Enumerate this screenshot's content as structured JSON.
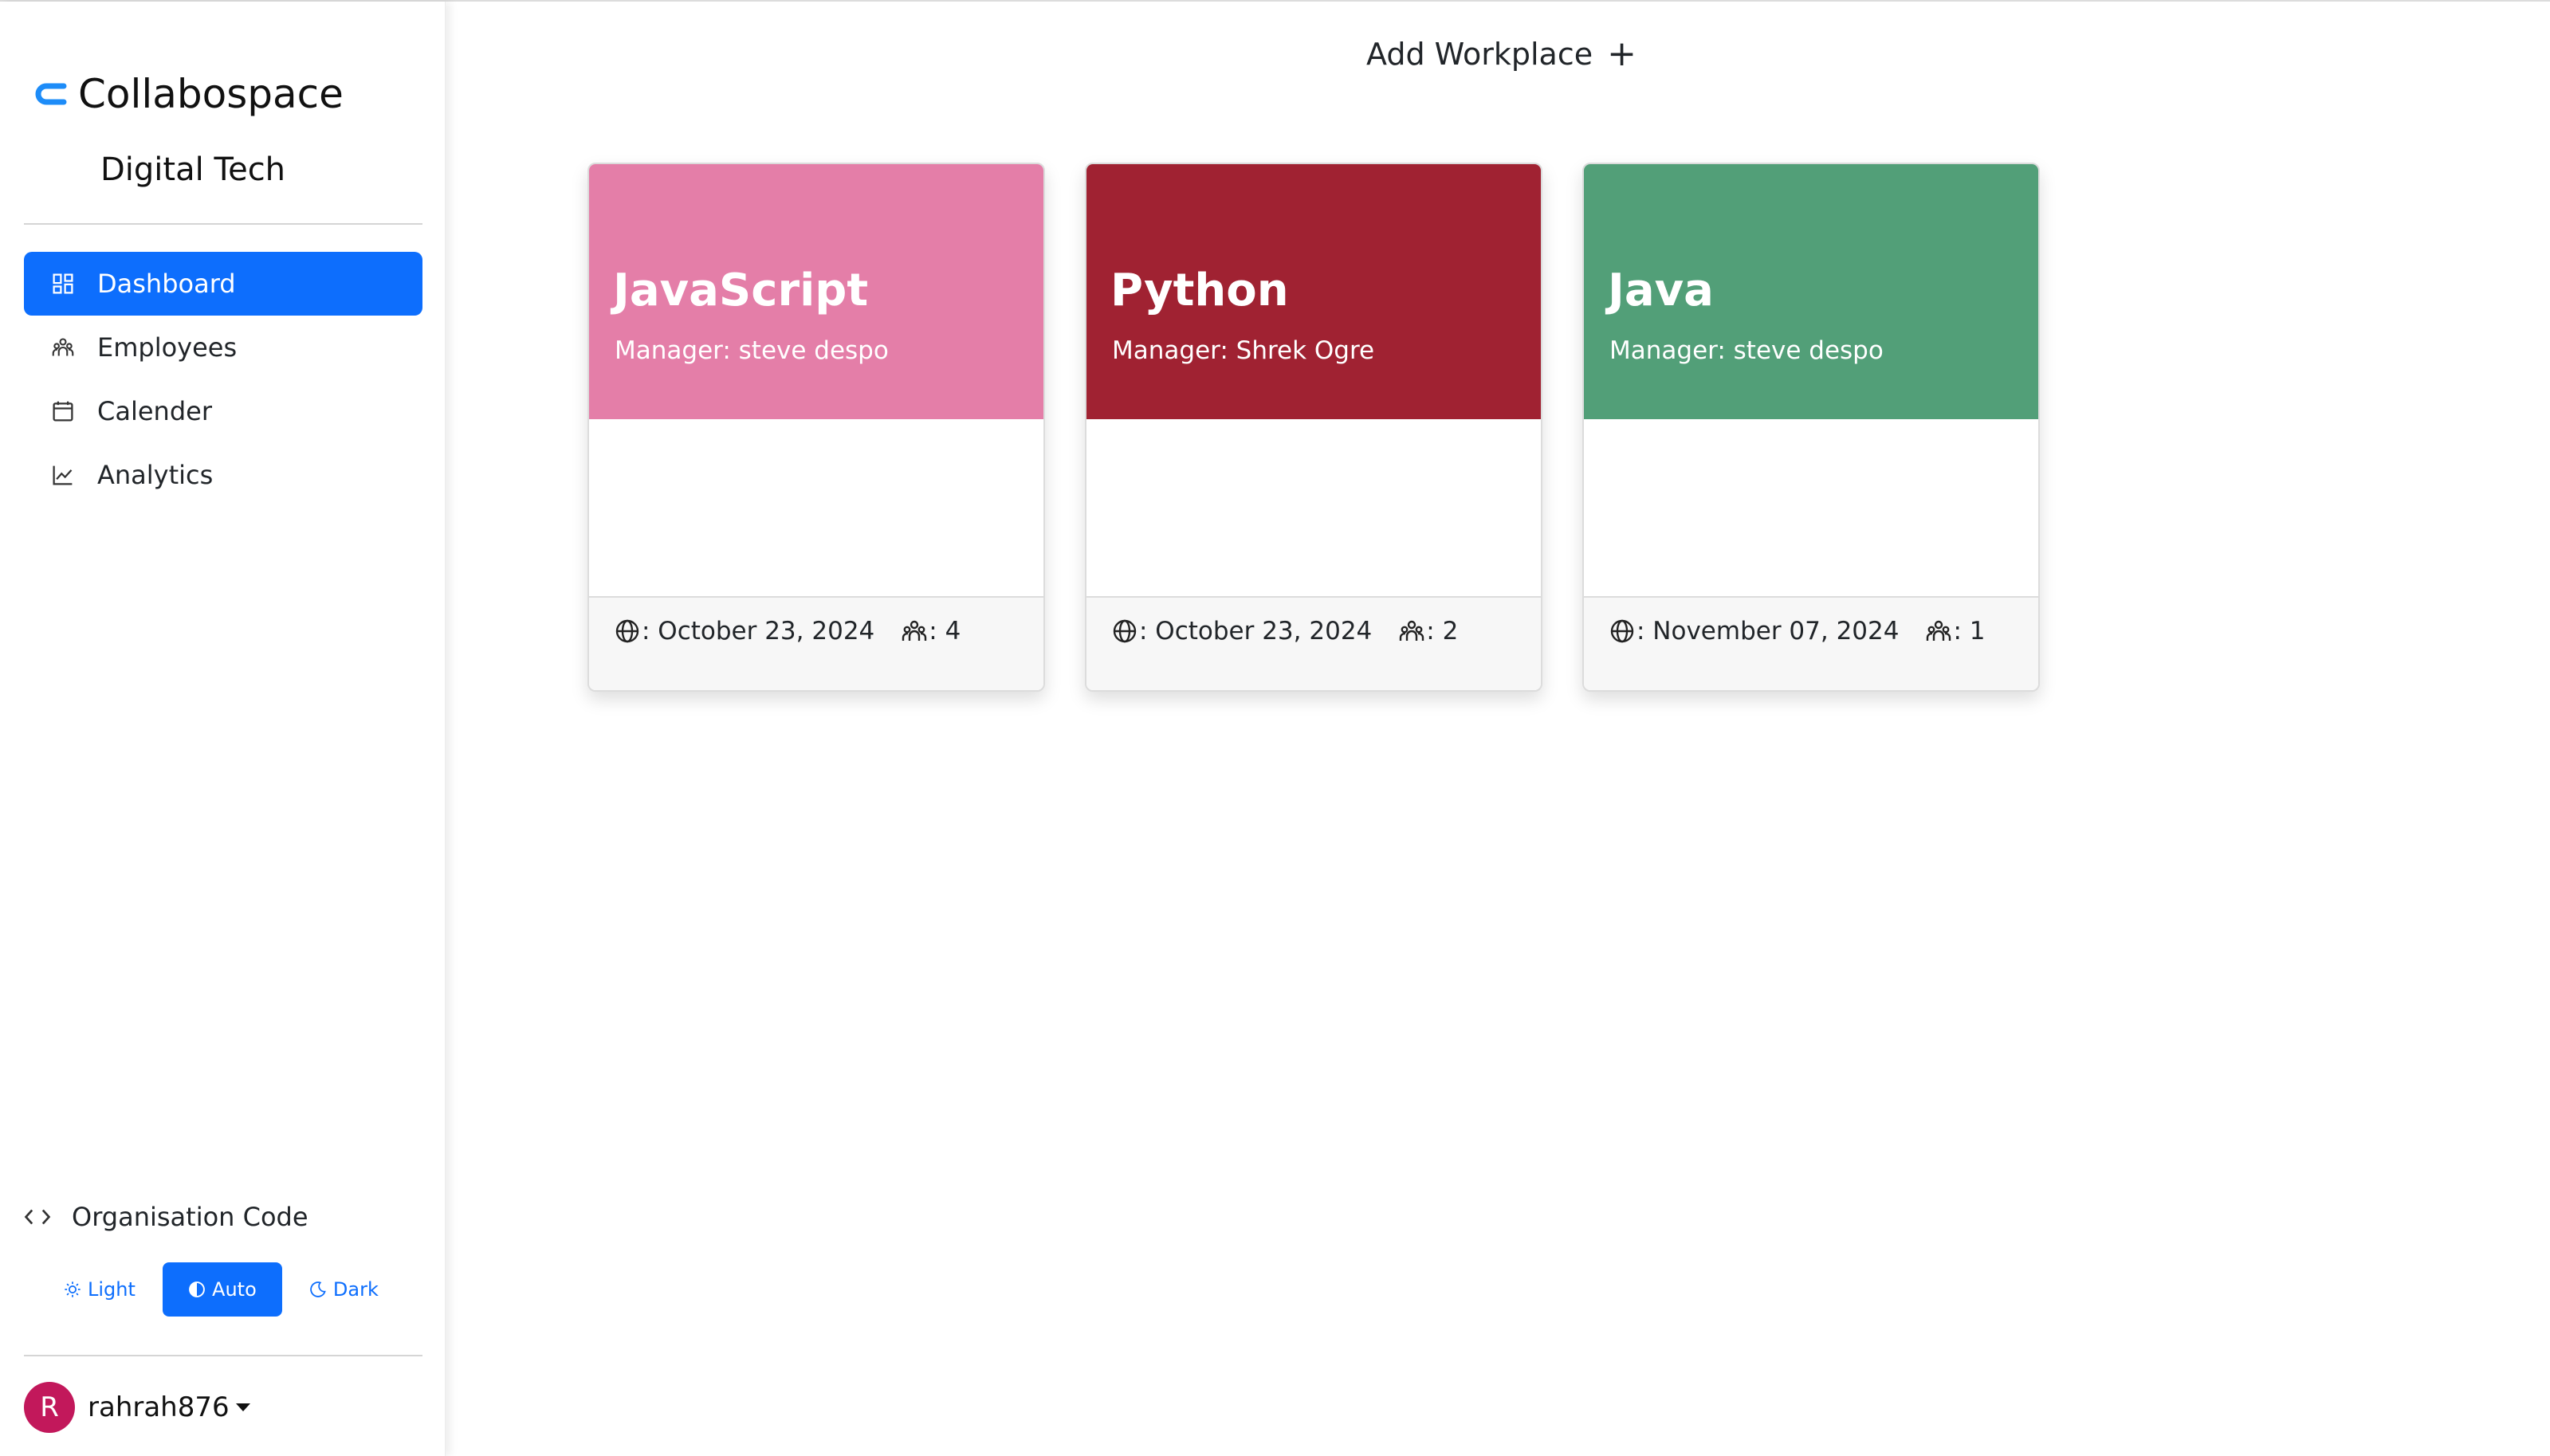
{
  "app": {
    "name": "Collabospace",
    "brand_color": "#0d6efd"
  },
  "organisation": {
    "name": "Digital Tech",
    "code_label": "Organisation Code"
  },
  "sidebar": {
    "items": [
      {
        "label": "Dashboard",
        "icon": "dashboard-icon",
        "active": true
      },
      {
        "label": "Employees",
        "icon": "people-icon",
        "active": false
      },
      {
        "label": "Calender",
        "icon": "calendar-icon",
        "active": false
      },
      {
        "label": "Analytics",
        "icon": "chart-line-icon",
        "active": false
      }
    ]
  },
  "theme": {
    "options": [
      {
        "label": "Light",
        "icon": "sun-icon"
      },
      {
        "label": "Auto",
        "icon": "circle-half-icon"
      },
      {
        "label": "Dark",
        "icon": "moon-icon"
      }
    ],
    "selected": "Auto"
  },
  "user": {
    "initial": "R",
    "username": "rahrah876",
    "avatar_color": "#c2185b"
  },
  "main": {
    "add_workplace_label": "Add Workplace",
    "add_icon": "+",
    "workplaces": [
      {
        "title": "JavaScript",
        "manager": "Manager: steve despo",
        "color": "#e47ea8",
        "date": ": October 23, 2024",
        "members": ": 4"
      },
      {
        "title": "Python",
        "manager": "Manager: Shrek Ogre",
        "color": "#a02232",
        "date": ": October 23, 2024",
        "members": ": 2"
      },
      {
        "title": "Java",
        "manager": "Manager: steve despo",
        "color": "#529f78",
        "date": ": November 07, 2024",
        "members": ": 1"
      }
    ]
  }
}
